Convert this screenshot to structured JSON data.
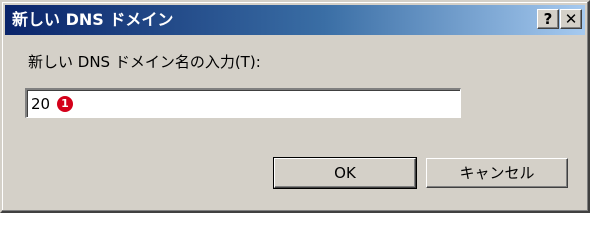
{
  "window": {
    "title": "新しい DNS ドメイン",
    "help_glyph": "?",
    "close_glyph": "✕",
    "help_icon": "help-icon",
    "close_icon": "close-icon"
  },
  "form": {
    "prompt_label": "新しい DNS ドメイン名の入力(T):",
    "input_value": "20",
    "marker_label": "1"
  },
  "buttons": {
    "ok_label": "OK",
    "cancel_label": "キャンセル"
  },
  "colors": {
    "titlebar_start": "#0a246a",
    "titlebar_end": "#a6caf0",
    "dialog_face": "#d4d0c8",
    "marker": "#d4001a"
  }
}
